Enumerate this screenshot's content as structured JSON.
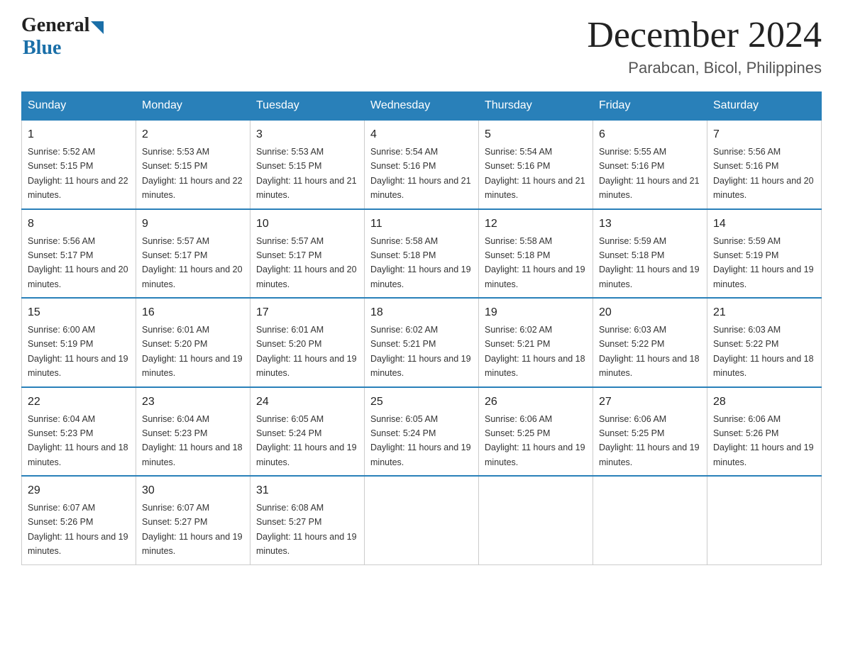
{
  "logo": {
    "general": "General",
    "blue": "Blue"
  },
  "title": "December 2024",
  "subtitle": "Parabcan, Bicol, Philippines",
  "days_of_week": [
    "Sunday",
    "Monday",
    "Tuesday",
    "Wednesday",
    "Thursday",
    "Friday",
    "Saturday"
  ],
  "weeks": [
    [
      {
        "day": "1",
        "sunrise": "5:52 AM",
        "sunset": "5:15 PM",
        "daylight": "11 hours and 22 minutes."
      },
      {
        "day": "2",
        "sunrise": "5:53 AM",
        "sunset": "5:15 PM",
        "daylight": "11 hours and 22 minutes."
      },
      {
        "day": "3",
        "sunrise": "5:53 AM",
        "sunset": "5:15 PM",
        "daylight": "11 hours and 21 minutes."
      },
      {
        "day": "4",
        "sunrise": "5:54 AM",
        "sunset": "5:16 PM",
        "daylight": "11 hours and 21 minutes."
      },
      {
        "day": "5",
        "sunrise": "5:54 AM",
        "sunset": "5:16 PM",
        "daylight": "11 hours and 21 minutes."
      },
      {
        "day": "6",
        "sunrise": "5:55 AM",
        "sunset": "5:16 PM",
        "daylight": "11 hours and 21 minutes."
      },
      {
        "day": "7",
        "sunrise": "5:56 AM",
        "sunset": "5:16 PM",
        "daylight": "11 hours and 20 minutes."
      }
    ],
    [
      {
        "day": "8",
        "sunrise": "5:56 AM",
        "sunset": "5:17 PM",
        "daylight": "11 hours and 20 minutes."
      },
      {
        "day": "9",
        "sunrise": "5:57 AM",
        "sunset": "5:17 PM",
        "daylight": "11 hours and 20 minutes."
      },
      {
        "day": "10",
        "sunrise": "5:57 AM",
        "sunset": "5:17 PM",
        "daylight": "11 hours and 20 minutes."
      },
      {
        "day": "11",
        "sunrise": "5:58 AM",
        "sunset": "5:18 PM",
        "daylight": "11 hours and 19 minutes."
      },
      {
        "day": "12",
        "sunrise": "5:58 AM",
        "sunset": "5:18 PM",
        "daylight": "11 hours and 19 minutes."
      },
      {
        "day": "13",
        "sunrise": "5:59 AM",
        "sunset": "5:18 PM",
        "daylight": "11 hours and 19 minutes."
      },
      {
        "day": "14",
        "sunrise": "5:59 AM",
        "sunset": "5:19 PM",
        "daylight": "11 hours and 19 minutes."
      }
    ],
    [
      {
        "day": "15",
        "sunrise": "6:00 AM",
        "sunset": "5:19 PM",
        "daylight": "11 hours and 19 minutes."
      },
      {
        "day": "16",
        "sunrise": "6:01 AM",
        "sunset": "5:20 PM",
        "daylight": "11 hours and 19 minutes."
      },
      {
        "day": "17",
        "sunrise": "6:01 AM",
        "sunset": "5:20 PM",
        "daylight": "11 hours and 19 minutes."
      },
      {
        "day": "18",
        "sunrise": "6:02 AM",
        "sunset": "5:21 PM",
        "daylight": "11 hours and 19 minutes."
      },
      {
        "day": "19",
        "sunrise": "6:02 AM",
        "sunset": "5:21 PM",
        "daylight": "11 hours and 18 minutes."
      },
      {
        "day": "20",
        "sunrise": "6:03 AM",
        "sunset": "5:22 PM",
        "daylight": "11 hours and 18 minutes."
      },
      {
        "day": "21",
        "sunrise": "6:03 AM",
        "sunset": "5:22 PM",
        "daylight": "11 hours and 18 minutes."
      }
    ],
    [
      {
        "day": "22",
        "sunrise": "6:04 AM",
        "sunset": "5:23 PM",
        "daylight": "11 hours and 18 minutes."
      },
      {
        "day": "23",
        "sunrise": "6:04 AM",
        "sunset": "5:23 PM",
        "daylight": "11 hours and 18 minutes."
      },
      {
        "day": "24",
        "sunrise": "6:05 AM",
        "sunset": "5:24 PM",
        "daylight": "11 hours and 19 minutes."
      },
      {
        "day": "25",
        "sunrise": "6:05 AM",
        "sunset": "5:24 PM",
        "daylight": "11 hours and 19 minutes."
      },
      {
        "day": "26",
        "sunrise": "6:06 AM",
        "sunset": "5:25 PM",
        "daylight": "11 hours and 19 minutes."
      },
      {
        "day": "27",
        "sunrise": "6:06 AM",
        "sunset": "5:25 PM",
        "daylight": "11 hours and 19 minutes."
      },
      {
        "day": "28",
        "sunrise": "6:06 AM",
        "sunset": "5:26 PM",
        "daylight": "11 hours and 19 minutes."
      }
    ],
    [
      {
        "day": "29",
        "sunrise": "6:07 AM",
        "sunset": "5:26 PM",
        "daylight": "11 hours and 19 minutes."
      },
      {
        "day": "30",
        "sunrise": "6:07 AM",
        "sunset": "5:27 PM",
        "daylight": "11 hours and 19 minutes."
      },
      {
        "day": "31",
        "sunrise": "6:08 AM",
        "sunset": "5:27 PM",
        "daylight": "11 hours and 19 minutes."
      },
      null,
      null,
      null,
      null
    ]
  ],
  "labels": {
    "sunrise": "Sunrise:",
    "sunset": "Sunset:",
    "daylight": "Daylight:"
  }
}
